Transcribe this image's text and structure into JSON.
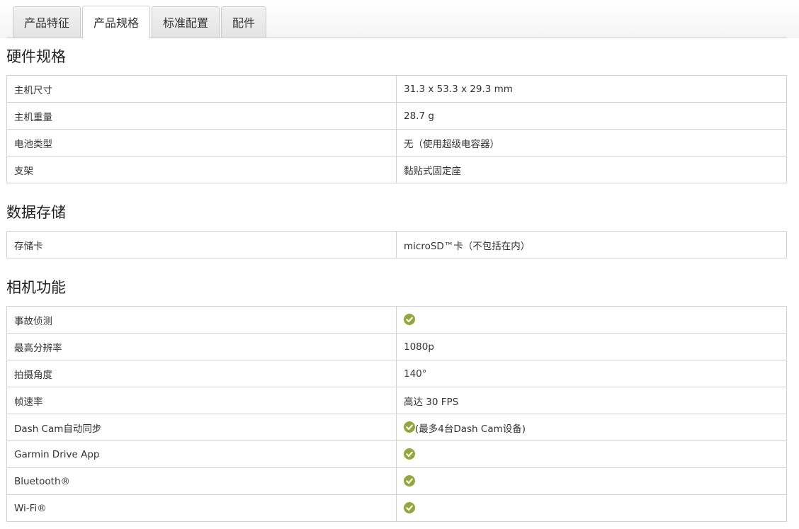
{
  "tabs": [
    {
      "label": "产品特征",
      "active": false
    },
    {
      "label": "产品规格",
      "active": true
    },
    {
      "label": "标准配置",
      "active": false
    },
    {
      "label": "配件",
      "active": false
    }
  ],
  "sections": [
    {
      "title": "硬件规格",
      "rows": [
        {
          "label": "主机尺寸",
          "value": "31.3 x 53.3 x 29.3 mm"
        },
        {
          "label": "主机重量",
          "value": "28.7 g"
        },
        {
          "label": "电池类型",
          "value": "无（使用超级电容器）"
        },
        {
          "label": "支架",
          "value": "黏贴式固定座"
        }
      ]
    },
    {
      "title": "数据存储",
      "rows": [
        {
          "label": "存储卡",
          "value": "microSD™卡（不包括在内）"
        }
      ]
    },
    {
      "title": "相机功能",
      "rows": [
        {
          "label": "事故侦测",
          "icon": "check-icon"
        },
        {
          "label": "最高分辨率",
          "value": "1080p"
        },
        {
          "label": "拍摄角度",
          "value": "140°"
        },
        {
          "label": "帧速率",
          "value": "高达 30 FPS"
        },
        {
          "label": "Dash Cam自动同步",
          "icon": "check-icon",
          "note": "(最多4台Dash Cam设备)"
        },
        {
          "label": "Garmin Drive App",
          "icon": "check-icon"
        },
        {
          "label": "Bluetooth®",
          "icon": "check-icon"
        },
        {
          "label": "Wi-Fi®",
          "icon": "check-icon"
        }
      ]
    }
  ],
  "colors": {
    "check": "#95a63a",
    "border": "#d2d2d2",
    "tab_border": "#cccccc"
  }
}
